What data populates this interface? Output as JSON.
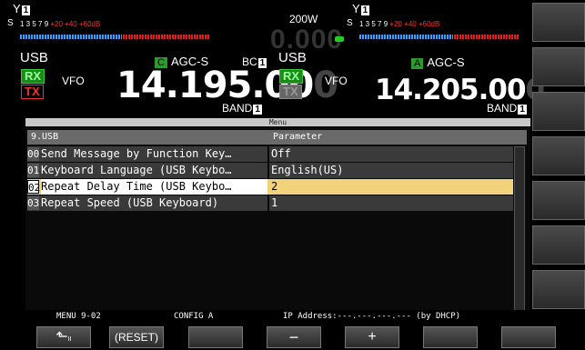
{
  "vfo_a": {
    "antenna": "1",
    "meter_scale": "1   3   5   7   9   +20  +40 +60dB",
    "meter_scale_main": "1   3   5   7   9",
    "meter_scale_red": "+20  +40 +60dB",
    "mode": "USB",
    "rx_label": "RX",
    "tx_label": "TX",
    "vfo_label": "VFO",
    "agc_badge": "C",
    "agc": "AGC-S",
    "bc": "BC",
    "bc_num": "1",
    "freq_main": "14.195.00",
    "freq_dim": "0",
    "band": "BAND",
    "band_num": "1"
  },
  "center": {
    "power": "200W",
    "power_readout": "0.000"
  },
  "vfo_b": {
    "antenna": "1",
    "meter_scale_main": "1   3   5   7   9",
    "meter_scale_red": "+20  +40 +60dB",
    "mode": "USB",
    "rx_label": "RX",
    "tx_label": "TX",
    "vfo_label": "VFO",
    "agc_badge": "A",
    "agc": "AGC-S",
    "freq_main": "14.205.00",
    "freq_dim": "0",
    "band": "BAND",
    "band_num": "1"
  },
  "menu": {
    "title": "Menu",
    "section": "9.USB",
    "param_header": "Parameter",
    "items": [
      {
        "no": "00",
        "name": "Send Message by Function Key…",
        "value": "Off"
      },
      {
        "no": "01",
        "name": "Keyboard Language (USB Keybo…",
        "value": "English(US)"
      },
      {
        "no": "02",
        "name": "Repeat Delay Time (USB Keybo…",
        "value": "2"
      },
      {
        "no": "03",
        "name": "Repeat Speed (USB Keyboard)",
        "value": "1"
      }
    ],
    "selected_index": 2
  },
  "status": {
    "menu_no": "MENU 9-02",
    "config": "CONFIG A",
    "ip": "IP Address:---.---.---.--- (by DHCP)"
  },
  "softkeys": {
    "back": "⬑",
    "back_sub": "II",
    "reset": "(RESET)",
    "minus": "−",
    "plus": "+"
  },
  "colors": {
    "selected_row": "#f2d27a",
    "rx_green": "#1a8a1a",
    "tx_red": "#e33333",
    "meter_blue": "#3aa0ff",
    "meter_red": "#e02020"
  }
}
